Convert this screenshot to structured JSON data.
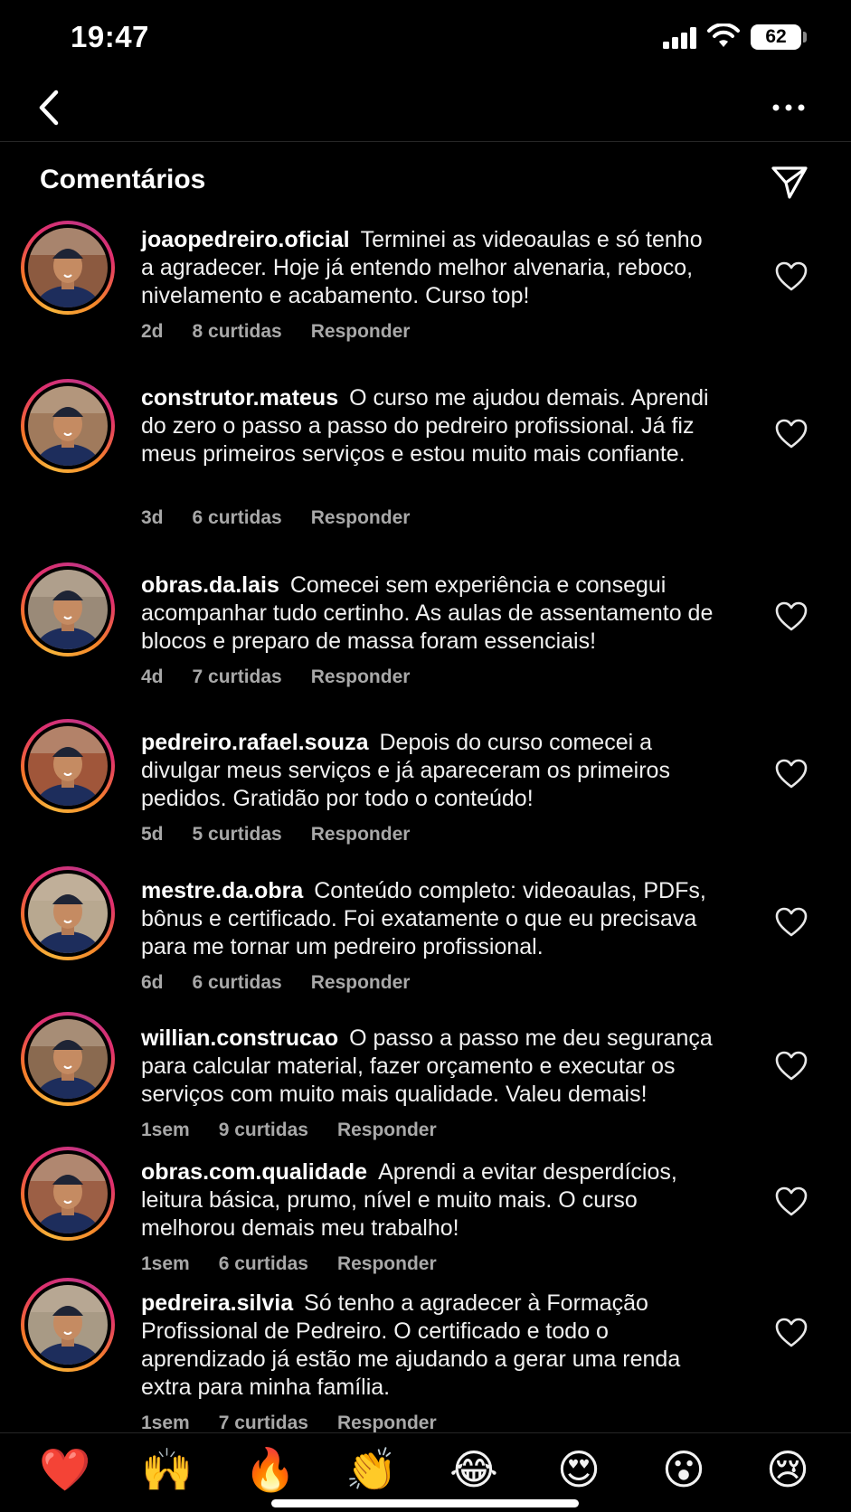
{
  "status": {
    "time": "19:47",
    "battery": "62"
  },
  "header": {
    "back_icon": "chevron-left-icon",
    "more_icon": "ellipsis-icon"
  },
  "section": {
    "title": "Comentários",
    "share_icon": "paper-plane-icon"
  },
  "comments": [
    {
      "username": "joaopedreiro.oficial",
      "text": "Terminei as videoaulas e só tenho a agradecer. Hoje já entendo melhor alvenaria, reboco, nivelamento e acabamento. Curso top!",
      "time": "2d",
      "likes": "8 curtidas",
      "reply": "Responder",
      "avatar_bg": "#8c5a40"
    },
    {
      "username": "construtor.mateus",
      "text": "O curso me ajudou demais. Aprendi do zero o passo a passo do pedreiro profissional. Já fiz meus primeiros serviços e estou muito mais confiante.",
      "time": "3d",
      "likes": "6 curtidas",
      "reply": "Responder",
      "avatar_bg": "#a07a5c"
    },
    {
      "username": "obras.da.lais",
      "text": "Comecei sem experiência e consegui acompanhar tudo certinho. As aulas de assentamento de blocos e preparo de massa foram essenciais!",
      "time": "4d",
      "likes": "7 curtidas",
      "reply": "Responder",
      "avatar_bg": "#9a8a78"
    },
    {
      "username": "pedreiro.rafael.souza",
      "text": "Depois do curso comecei a divulgar meus serviços e já apareceram os primeiros pedidos. Gratidão por todo o conteúdo!",
      "time": "5d",
      "likes": "5 curtidas",
      "reply": "Responder",
      "avatar_bg": "#a0563a"
    },
    {
      "username": "mestre.da.obra",
      "text": "Conteúdo completo: videoaulas, PDFs, bônus e certificado. Foi exatamente o que eu precisava para me tornar um pedreiro profissional.",
      "time": "6d",
      "likes": "6 curtidas",
      "reply": "Responder",
      "avatar_bg": "#b8a890"
    },
    {
      "username": "willian.construcao",
      "text": "O passo a passo me deu segurança para calcular material, fazer orçamento e executar os serviços com muito mais qualidade. Valeu demais!",
      "time": "1sem",
      "likes": "9 curtidas",
      "reply": "Responder",
      "avatar_bg": "#8a6a50"
    },
    {
      "username": "obras.com.qualidade",
      "text": "Aprendi a evitar desperdícios, leitura básica, prumo, nível e muito mais. O curso melhorou demais meu trabalho!",
      "time": "1sem",
      "likes": "6 curtidas",
      "reply": "Responder",
      "avatar_bg": "#9c5f45"
    },
    {
      "username": "pedreira.silvia",
      "text": "Só tenho a agradecer à Formação Profissional de Pedreiro. O certificado e todo o aprendizado já estão me ajudando a gerar uma renda extra para minha família.",
      "time": "1sem",
      "likes": "7 curtidas",
      "reply": "Responder",
      "avatar_bg": "#a89a85"
    }
  ],
  "reactions": [
    {
      "emoji": "❤️",
      "icon": "red-heart-emoji"
    },
    {
      "emoji": "🙌",
      "icon": "raised-hands-emoji"
    },
    {
      "emoji": "🔥",
      "icon": "fire-emoji"
    },
    {
      "emoji": "👏",
      "icon": "clapping-hands-emoji"
    },
    {
      "emoji": "😂",
      "icon": "tears-of-joy-emoji"
    },
    {
      "emoji": "😍",
      "icon": "heart-eyes-emoji"
    },
    {
      "emoji": "😮",
      "icon": "open-mouth-emoji"
    },
    {
      "emoji": "😢",
      "icon": "crying-face-emoji"
    }
  ]
}
